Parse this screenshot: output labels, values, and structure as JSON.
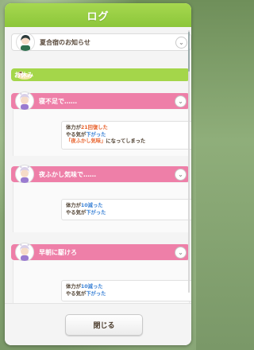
{
  "dialog": {
    "title": "ログ",
    "close_label": "閉じる"
  },
  "log": {
    "notice_label": "夏合宿のお知らせ",
    "rest_label": "お休み",
    "entries": [
      {
        "title": "寝不足で……",
        "line1_a": "体力が",
        "line1_b": "21回復した",
        "line2_a": "やる気が",
        "line2_b": "下がった",
        "line3_a": "「夜ふかし気味」",
        "line3_b": "になってしまった"
      },
      {
        "title": "夜ふかし気味で……",
        "line1_a": "体力が",
        "line1_b": "10減った",
        "line2_a": "やる気が",
        "line2_b": "下がった"
      },
      {
        "title": "早朝に駆けろ",
        "line1_a": "体力が",
        "line1_b": "10減った",
        "line2_a": "やる気が",
        "line2_b": "下がった"
      }
    ]
  },
  "icons": [
    "chevron-down-icon",
    "character-avatar",
    "sleeping-character-icon"
  ],
  "colors": {
    "title_bar": "#8cc63a",
    "rest_bar": "#a4d64a",
    "event_bar": "#ee7fa8",
    "decrease": "#3b82d6",
    "increase": "#e8622c"
  }
}
